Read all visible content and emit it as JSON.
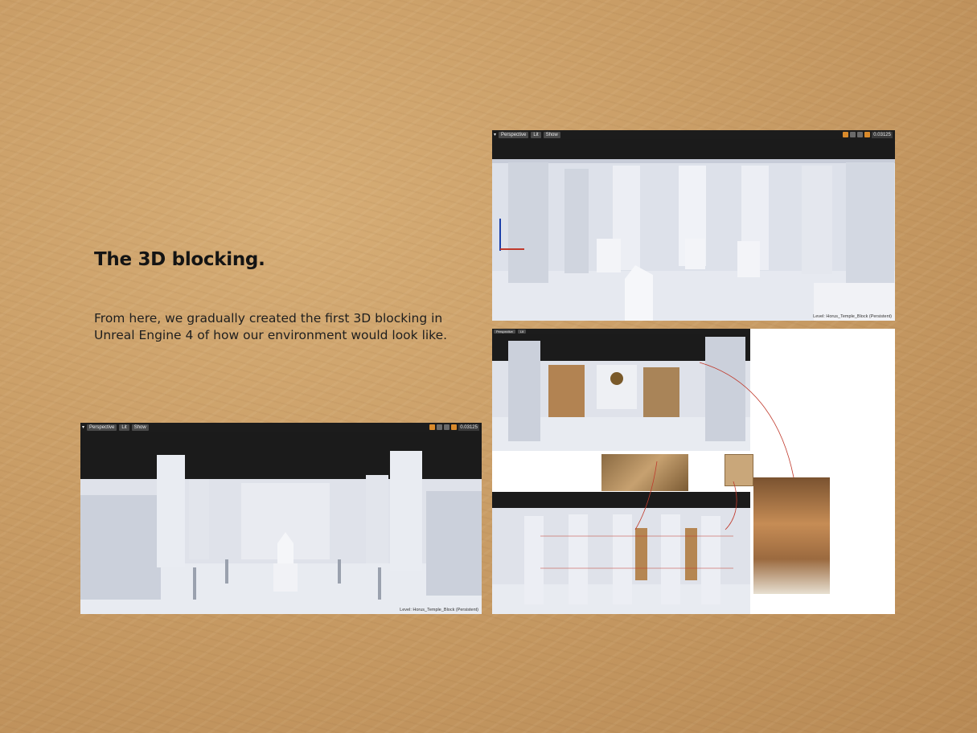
{
  "slide": {
    "heading": "The 3D blocking.",
    "body": "From here, we gradually created the first 3D blocking in Unreal Engine 4 of how our environment would look like."
  },
  "viewport": {
    "perspective_label": "Perspective",
    "lit_label": "Lit",
    "show_label": "Show",
    "speed_value": "0.03125",
    "level_label": "Level:  Horus_Temple_Block (Persistent)"
  },
  "colors": {
    "background": "#c99d66",
    "toolbar": "#1c1c1c",
    "toolbar_accent": "#d98a2b",
    "annotation": "#c0392b"
  },
  "icons": [
    "viewport-menu-icon",
    "translate-icon",
    "rotate-icon",
    "scale-icon",
    "snap-icon",
    "camera-speed-icon",
    "axis-gizmo-icon"
  ]
}
